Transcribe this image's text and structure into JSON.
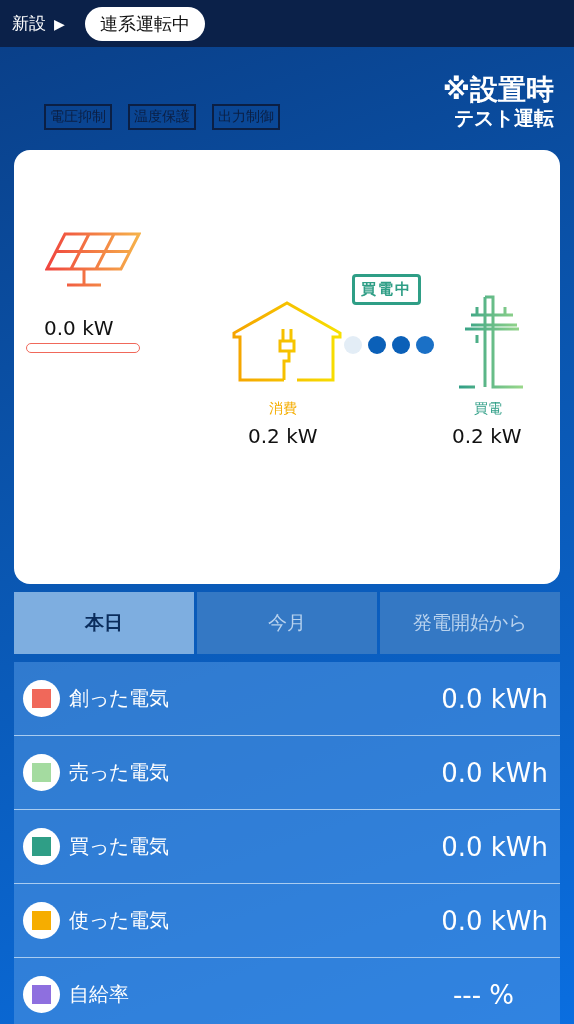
{
  "header": {
    "breadcrumb": "新設",
    "arrow": "▶",
    "status": "連系運転中"
  },
  "notice": {
    "line_1": "※設置時",
    "line_2": "テスト運転"
  },
  "flags": [
    {
      "label": "電圧抑制",
      "on": false
    },
    {
      "label": "温度保護",
      "on": false
    },
    {
      "label": "出力制御",
      "on": false
    }
  ],
  "flow": {
    "solar": {
      "value": "0.0 kW",
      "level": 0
    },
    "house": {
      "label": "消費",
      "value": "0.2 kW"
    },
    "badge": "買電中",
    "grid": {
      "label": "買電",
      "value": "0.2 kW"
    }
  },
  "tabs": [
    {
      "label": "本日",
      "selected": true
    },
    {
      "label": "今月",
      "selected": false
    },
    {
      "label": "発電開始から",
      "selected": false
    }
  ],
  "rows": [
    {
      "label": "創った電気",
      "value": "0.0 kWh",
      "color": "#f0685a"
    },
    {
      "label": "売った電気",
      "value": "0.0 kWh",
      "color": "#a4dba0"
    },
    {
      "label": "買った電気",
      "value": "0.0 kWh",
      "color": "#2f9e86"
    },
    {
      "label": "使った電気",
      "value": "0.0 kWh",
      "color": "#f6ad00"
    },
    {
      "label": "自給率",
      "value": "--- %",
      "color": "#8e6fdf"
    }
  ]
}
